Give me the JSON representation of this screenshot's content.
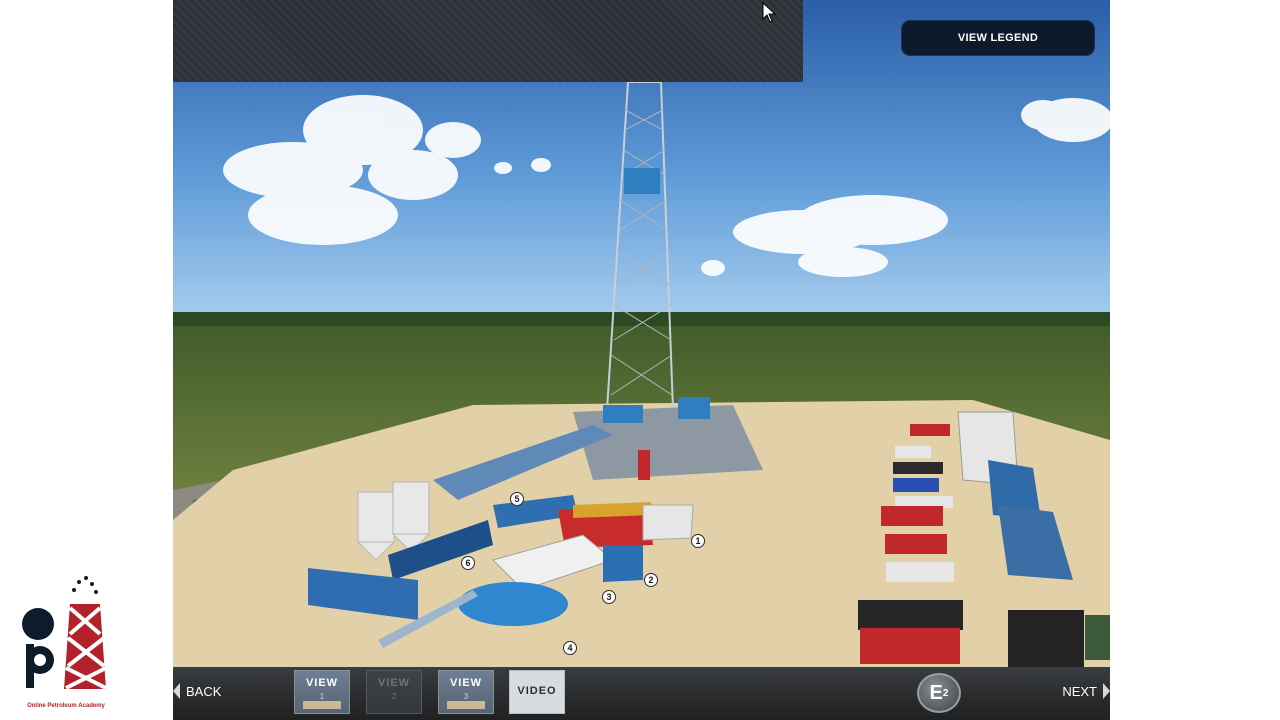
{
  "header": {
    "legend_button_label": "VIEW LEGEND"
  },
  "nav": {
    "back_label": "BACK",
    "next_label": "NEXT"
  },
  "views": [
    {
      "label": "VIEW",
      "number": "1",
      "state": "active"
    },
    {
      "label": "VIEW",
      "number": "2",
      "state": "disabled"
    },
    {
      "label": "VIEW",
      "number": "3",
      "state": "normal"
    }
  ],
  "video_label": "VIDEO",
  "brand_badge": {
    "letter": "E",
    "superscript": "2"
  },
  "callouts": [
    "1",
    "2",
    "3",
    "4",
    "5",
    "6"
  ],
  "logo": {
    "caption": "Online Petroleum Academy"
  },
  "colors": {
    "sky_top": "#2a5ea8",
    "sky_horizon": "#9cc7ea",
    "pad": "#e2d1a8",
    "logo_red": "#b3222b",
    "logo_dark": "#0d1b2a"
  }
}
